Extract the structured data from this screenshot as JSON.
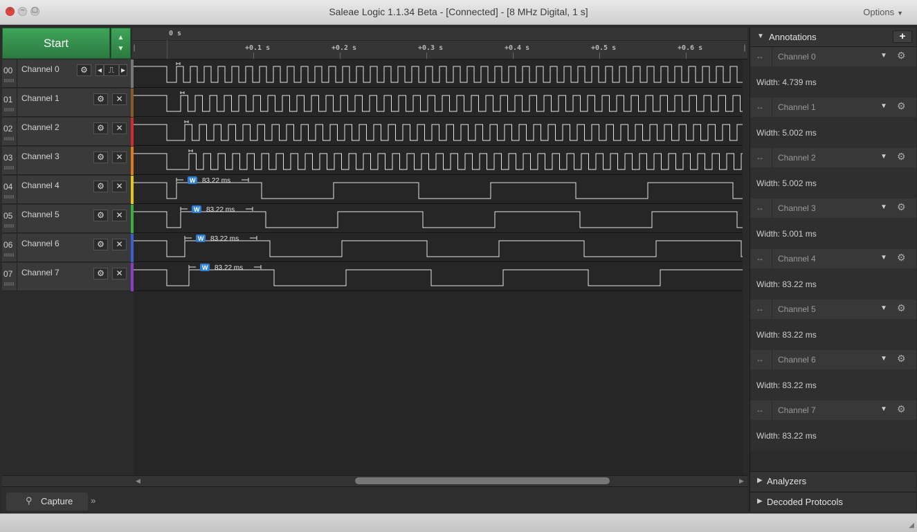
{
  "window": {
    "title": "Saleae Logic 1.1.34 Beta - [Connected] - [8 MHz Digital, 1 s]",
    "options_label": "Options",
    "close_glyph": "×",
    "min_glyph": "–",
    "max_glyph": "▢"
  },
  "capture": {
    "start_label": "Start"
  },
  "ruler": {
    "zero_label": "0 s",
    "ticks": [
      "+0.1 s",
      "+0.2 s",
      "+0.3 s",
      "+0.4 s",
      "+0.5 s",
      "+0.6 s"
    ]
  },
  "channels": [
    {
      "num": "00",
      "name": "Channel 0",
      "color": "#777777"
    },
    {
      "num": "01",
      "name": "Channel 1",
      "color": "#8a5a2b"
    },
    {
      "num": "02",
      "name": "Channel 2",
      "color": "#d12b2b"
    },
    {
      "num": "03",
      "name": "Channel 3",
      "color": "#e07a1f"
    },
    {
      "num": "04",
      "name": "Channel 4",
      "color": "#e6c41a"
    },
    {
      "num": "05",
      "name": "Channel 5",
      "color": "#3cae3c"
    },
    {
      "num": "06",
      "name": "Channel 6",
      "color": "#3a5fd0"
    },
    {
      "num": "07",
      "name": "Channel 7",
      "color": "#8e3cc4"
    }
  ],
  "measurements": {
    "w_badge": "W",
    "width_label": "83.22 ms"
  },
  "annotations": {
    "header": "Annotations",
    "add_glyph": "+",
    "items": [
      {
        "channel": "Channel 0",
        "value": "Width: 4.739 ms"
      },
      {
        "channel": "Channel 1",
        "value": "Width: 5.002 ms"
      },
      {
        "channel": "Channel 2",
        "value": "Width: 5.002 ms"
      },
      {
        "channel": "Channel 3",
        "value": "Width: 5.001 ms"
      },
      {
        "channel": "Channel 4",
        "value": "Width: 83.22 ms"
      },
      {
        "channel": "Channel 5",
        "value": "Width: 83.22 ms"
      },
      {
        "channel": "Channel 6",
        "value": "Width: 83.22 ms"
      },
      {
        "channel": "Channel 7",
        "value": "Width: 83.22 ms"
      }
    ]
  },
  "sections": {
    "analyzers": "Analyzers",
    "decoded_protocols": "Decoded Protocols"
  },
  "tabs": {
    "capture": "Capture",
    "more": "»"
  }
}
